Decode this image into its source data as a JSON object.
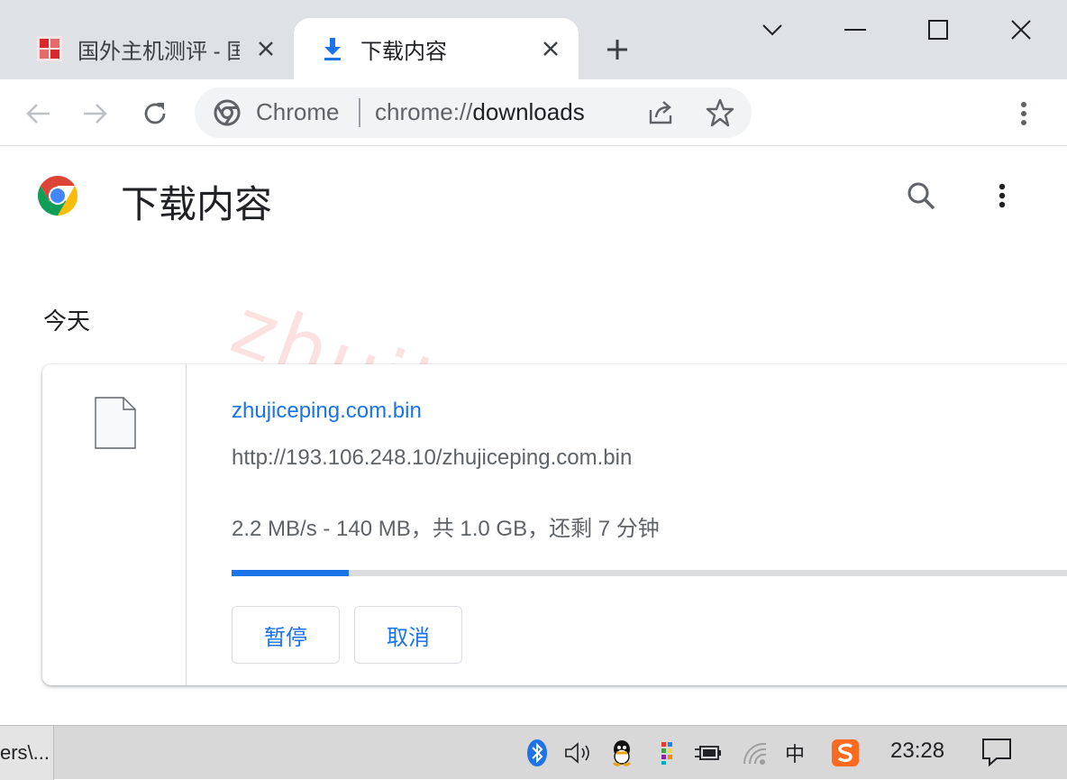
{
  "tabs": [
    {
      "title": "国外主机测评 - 国",
      "active": false,
      "favicon": "site-favicon"
    },
    {
      "title": "下载内容",
      "active": true,
      "favicon": "download-icon"
    }
  ],
  "omnibox": {
    "label": "Chrome",
    "url_scheme": "chrome://",
    "url_host": "downloads"
  },
  "page": {
    "title": "下载内容"
  },
  "section": {
    "date": "今天"
  },
  "download": {
    "filename": "zhujiceping.com.bin",
    "url": "http://193.106.248.10/zhujiceping.com.bin",
    "status": "2.2 MB/s - 140 MB，共 1.0 GB，还剩 7 分钟",
    "progress_fraction": 0.137,
    "pause_label": "暂停",
    "cancel_label": "取消"
  },
  "watermark": "zhujiceping.com",
  "taskbar": {
    "app_label": "ers\\...",
    "ime_label": "中",
    "clock": "23:28"
  },
  "colors": {
    "accent": "#1a73e8",
    "tabstrip": "#dee1e6"
  }
}
